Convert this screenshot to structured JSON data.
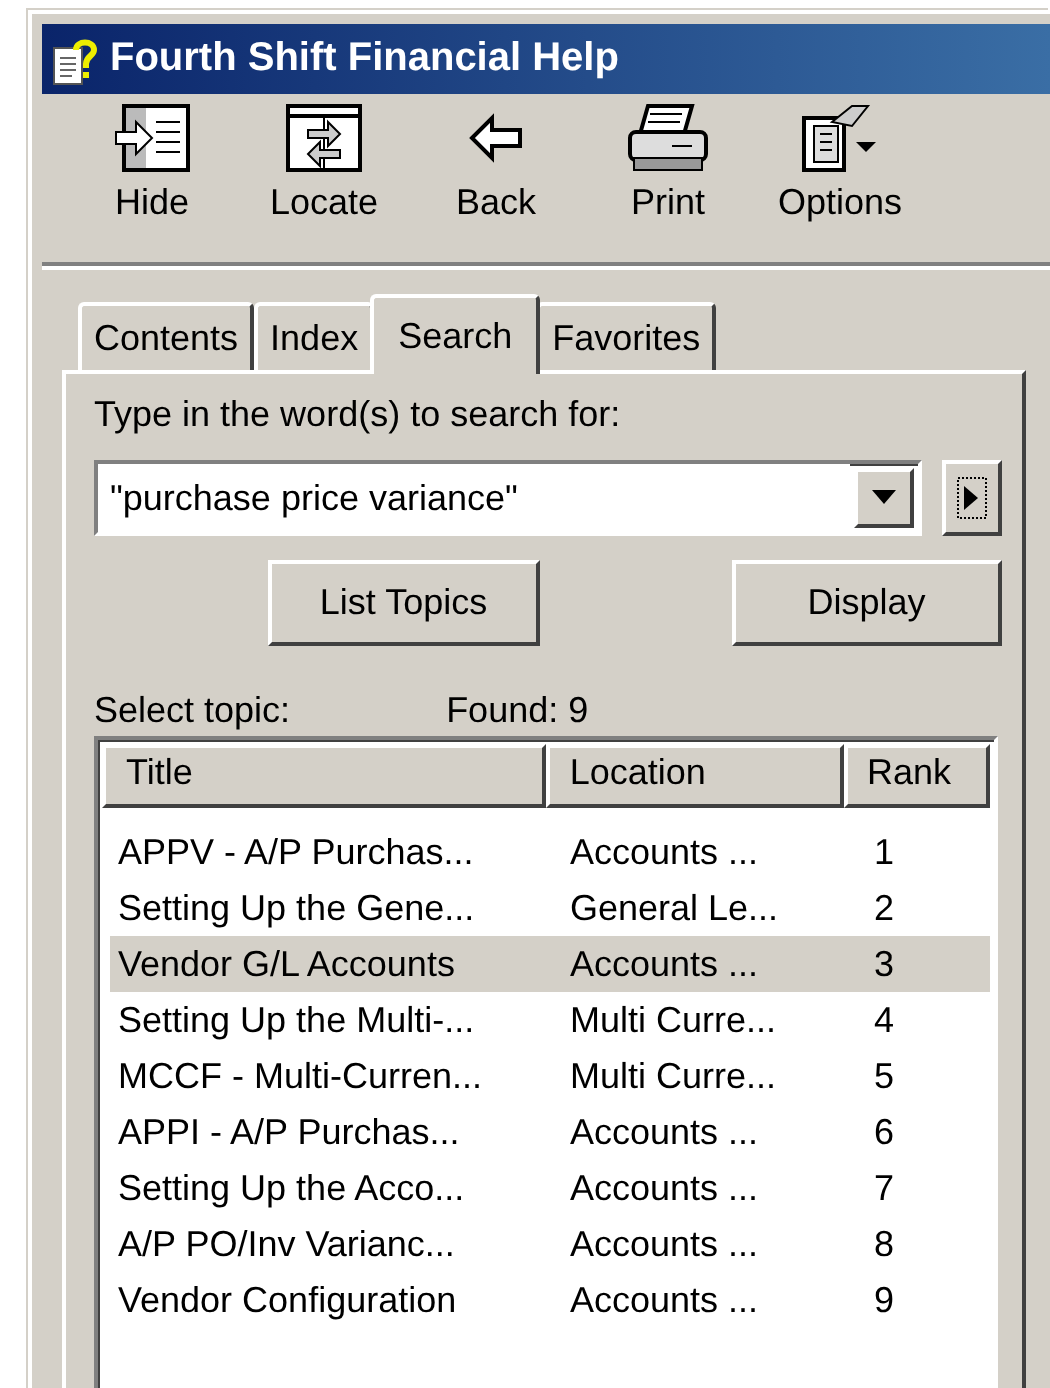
{
  "window": {
    "title": "Fourth Shift Financial Help"
  },
  "toolbar": [
    {
      "label": "Hide",
      "kind": "hide"
    },
    {
      "label": "Locate",
      "kind": "locate"
    },
    {
      "label": "Back",
      "kind": "back"
    },
    {
      "label": "Print",
      "kind": "print"
    },
    {
      "label": "Options",
      "kind": "options"
    }
  ],
  "tabs": [
    {
      "label": "Contents",
      "selected": false
    },
    {
      "label": "Index",
      "selected": false
    },
    {
      "label": "Search",
      "selected": true
    },
    {
      "label": "Favorites",
      "selected": false
    }
  ],
  "search": {
    "prompt": "Type in the word(s) to search for:",
    "value": "\"purchase price variance\"",
    "buttons": [
      "List Topics",
      "Display"
    ]
  },
  "results": {
    "label": "Select topic:",
    "found": "Found: 9",
    "columns": [
      "Title",
      "Location",
      "Rank"
    ],
    "rows": [
      {
        "title": "APPV - A/P Purchas...",
        "location": "Accounts ...",
        "rank": "1",
        "selected": false
      },
      {
        "title": "Setting Up the Gene...",
        "location": "General Le...",
        "rank": "2",
        "selected": false
      },
      {
        "title": "Vendor G/L Accounts",
        "location": "Accounts ...",
        "rank": "3",
        "selected": true
      },
      {
        "title": "Setting Up the Multi-...",
        "location": "Multi Curre...",
        "rank": "4",
        "selected": false
      },
      {
        "title": "MCCF - Multi-Curren...",
        "location": "Multi Curre...",
        "rank": "5",
        "selected": false
      },
      {
        "title": "APPI - A/P Purchas...",
        "location": "Accounts ...",
        "rank": "6",
        "selected": false
      },
      {
        "title": "Setting Up the Acco...",
        "location": "Accounts ...",
        "rank": "7",
        "selected": false
      },
      {
        "title": "A/P PO/Inv Varianc...",
        "location": "Accounts ...",
        "rank": "8",
        "selected": false
      },
      {
        "title": "Vendor Configuration",
        "location": "Accounts ...",
        "rank": "9",
        "selected": false
      }
    ]
  }
}
